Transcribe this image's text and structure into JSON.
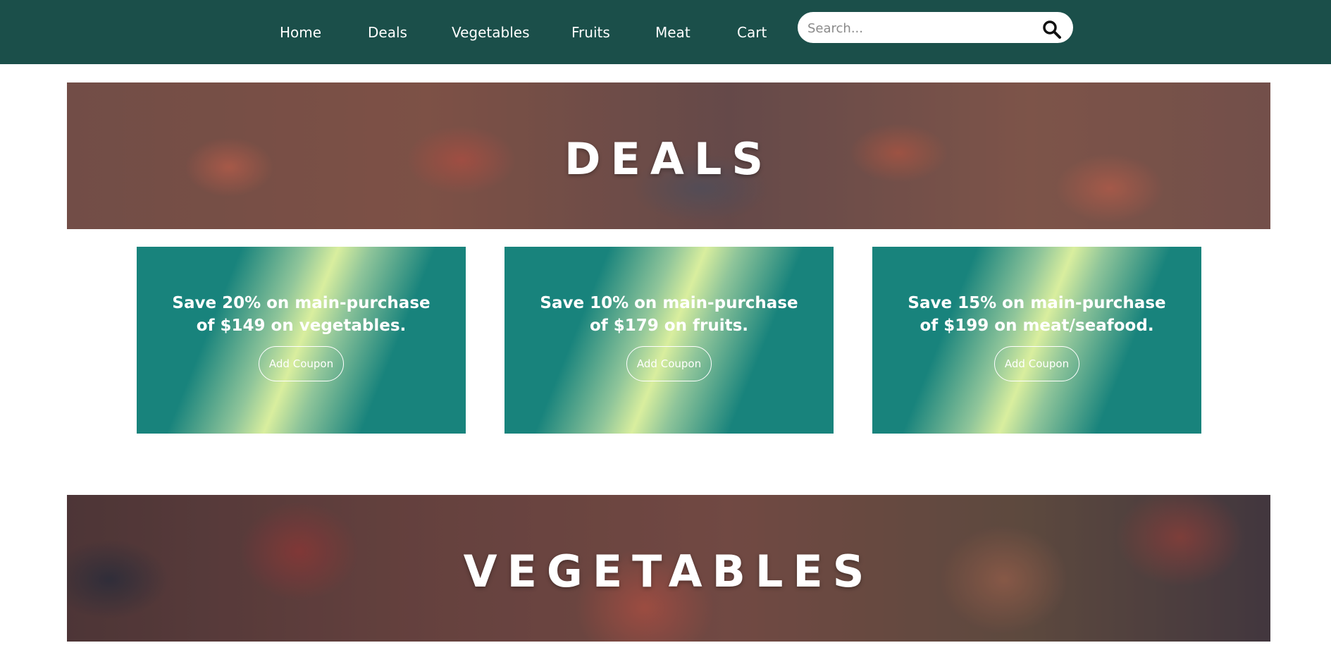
{
  "nav": {
    "items": [
      {
        "label": "Home"
      },
      {
        "label": "Deals"
      },
      {
        "label": "Vegetables"
      },
      {
        "label": "Fruits"
      },
      {
        "label": "Meat"
      },
      {
        "label": "Cart"
      }
    ],
    "search": {
      "placeholder": "Search...",
      "value": "",
      "icon": "search-icon"
    },
    "background_color": "#1b4f4a"
  },
  "banners": {
    "deals": {
      "title": "DEALS"
    },
    "vegetables": {
      "title": "VEGETABLES"
    }
  },
  "deals": [
    {
      "line1": "Save 20% on main-purchase",
      "line2": "of $149 on vegetables.",
      "button": "Add Coupon"
    },
    {
      "line1": "Save 10% on main-purchase",
      "line2": "of $179 on fruits.",
      "button": "Add Coupon"
    },
    {
      "line1": "Save 15% on main-purchase",
      "line2": "of $199 on meat/seafood.",
      "button": "Add Coupon"
    }
  ],
  "colors": {
    "card_teal": "#18837c",
    "card_highlight": "#d9ee9e"
  }
}
